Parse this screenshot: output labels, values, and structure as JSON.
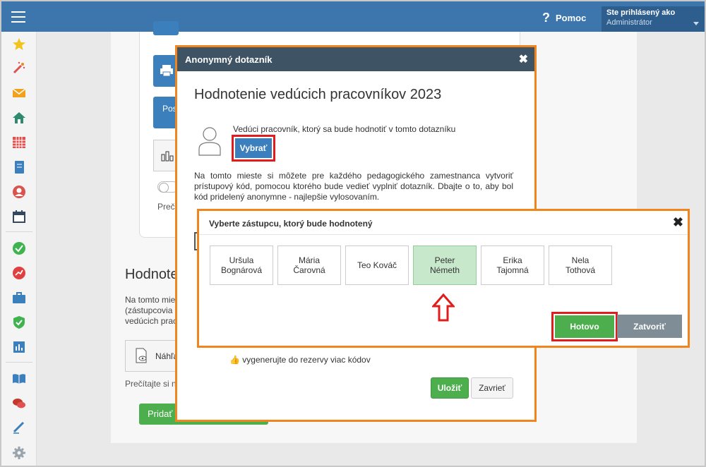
{
  "topbar": {
    "help_label": "Pomoc",
    "help_icon": "question-icon",
    "user_prefix": "Ste prihlásený ako",
    "user_name": "Administrátor"
  },
  "sidebar": {
    "icons": [
      "star-icon",
      "magic-wand-icon",
      "envelope-icon",
      "home-icon",
      "calendar-grid-icon",
      "notebook-icon",
      "user-icon",
      "calendar-icon",
      "check-circle-icon",
      "chart-circle-icon",
      "briefcase-icon",
      "shield-check-icon",
      "bar-chart-icon",
      "book-icon",
      "chat-icon",
      "pen-icon",
      "gear-icon"
    ],
    "colors": {
      "accent": "#3c76ad"
    }
  },
  "background": {
    "btn_label": "Pos",
    "small_text": "Preč",
    "heading": "Hodnote",
    "para": "Na tomto mie (zástupcovia vedúcich prac",
    "box_label": "Náhľa",
    "footer_text": "Prečítajte si n",
    "green_btn": "Pridať d"
  },
  "dialog1": {
    "header": "Anonymný dotazník",
    "title": "Hodnotenie vedúcich pracovníkov 2023",
    "employee_label": "Vedúci pracovník, ktorý sa bude hodnotiť v tomto dotazníku",
    "select_button": "Vybrať",
    "paragraph": "Na tomto mieste si môžete pre každého pedagogického zamestnanca vytvoriť prístupový kód, pomocou ktorého bude vedieť vyplniť dotazník. Dbajte o to, aby bol kód pridelený anonymne - najlepšie vylosovaním.",
    "generate_text": "vygenerujte do rezervy viac kódov",
    "save_button": "Uložiť",
    "close_button": "Zavrieť"
  },
  "dialog2": {
    "header": "Vyberte zástupcu, ktorý bude hodnotený",
    "people": [
      {
        "name": "Uršula\nBognárová",
        "selected": false
      },
      {
        "name": "Mária\nČarovná",
        "selected": false
      },
      {
        "name": "Teo Kováč",
        "selected": false
      },
      {
        "name": "Peter\nNémeth",
        "selected": true
      },
      {
        "name": "Erika\nTajomná",
        "selected": false
      },
      {
        "name": "Nela\nTothová",
        "selected": false
      }
    ],
    "done_button": "Hotovo",
    "close_button": "Zatvoriť",
    "colors": {
      "highlight": "#e01c1c",
      "frame": "#f0851e",
      "selected": "#c8e8cb"
    }
  }
}
